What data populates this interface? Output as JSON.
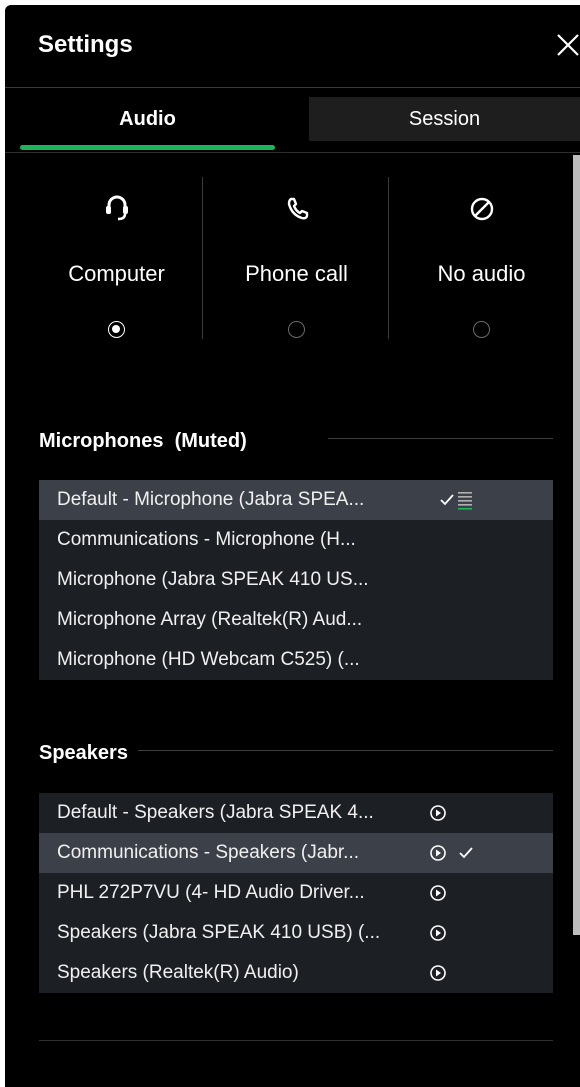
{
  "title": "Settings",
  "tabs": [
    {
      "label": "Audio",
      "active": true
    },
    {
      "label": "Session",
      "active": false
    }
  ],
  "audio_options": [
    {
      "label": "Computer",
      "icon": "headset-icon",
      "selected": true
    },
    {
      "label": "Phone call",
      "icon": "phone-icon",
      "selected": false
    },
    {
      "label": "No audio",
      "icon": "no-audio-icon",
      "selected": false
    }
  ],
  "microphones": {
    "title": "Microphones  (Muted)",
    "items": [
      {
        "label": "Default - Microphone (Jabra SPEA...",
        "selected": true,
        "checked": true,
        "level_meter": true
      },
      {
        "label": "Communications - Microphone (H...",
        "selected": false
      },
      {
        "label": "Microphone (Jabra SPEAK 410 US...",
        "selected": false
      },
      {
        "label": "Microphone Array (Realtek(R) Aud...",
        "selected": false
      },
      {
        "label": "Microphone (HD Webcam C525) (...",
        "selected": false
      }
    ]
  },
  "speakers": {
    "title": "Speakers",
    "items": [
      {
        "label": "Default - Speakers (Jabra SPEAK 4...",
        "selected": false,
        "checked": false
      },
      {
        "label": "Communications - Speakers (Jabr...",
        "selected": true,
        "checked": true
      },
      {
        "label": "PHL 272P7VU (4- HD Audio Driver...",
        "selected": false,
        "checked": false
      },
      {
        "label": "Speakers (Jabra SPEAK 410 USB) (...",
        "selected": false,
        "checked": false
      },
      {
        "label": "Speakers (Realtek(R) Audio)",
        "selected": false,
        "checked": false
      }
    ]
  },
  "colors": {
    "accent": "#1bb55c",
    "background": "#000000",
    "list_bg": "#1c1f24",
    "selected_bg": "#3c4149"
  }
}
